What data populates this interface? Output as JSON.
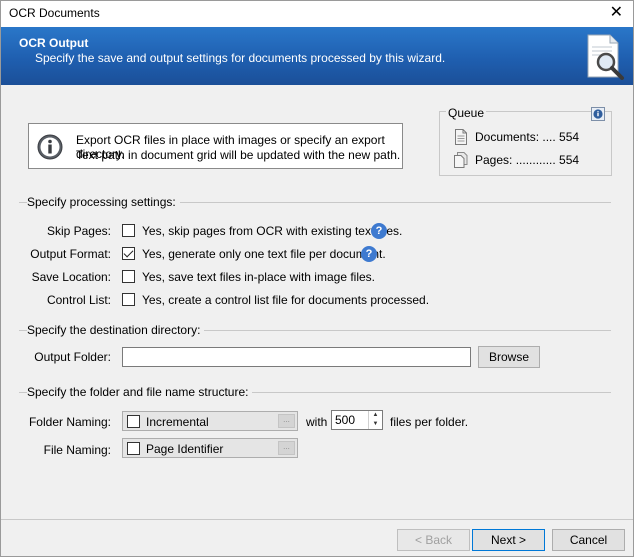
{
  "window": {
    "title": "OCR Documents",
    "close_glyph": "✕"
  },
  "banner": {
    "title": "OCR Output",
    "subtitle": "Specify the save and output settings for documents processed by this wizard.",
    "icon": "document-magnifier-icon"
  },
  "info": {
    "line1": "Export OCR files in place with images or specify an export directory.",
    "line2": "Text path in document grid will be updated with the new path."
  },
  "queue": {
    "title": "Queue",
    "documents_label": "Documents: ....",
    "documents_value": "554",
    "pages_label": "Pages: ............",
    "pages_value": "554"
  },
  "processing": {
    "section_label": "Specify processing settings:",
    "skip_pages": {
      "label": "Skip Pages:",
      "text": "Yes, skip pages from OCR with existing text files.",
      "checked": false
    },
    "output_format": {
      "label": "Output Format:",
      "text": "Yes, generate only one text file per document.",
      "checked": true
    },
    "save_location": {
      "label": "Save Location:",
      "text": "Yes, save text files in-place with image files.",
      "checked": false
    },
    "control_list": {
      "label": "Control List:",
      "text": "Yes, create a control list file for documents processed.",
      "checked": false
    },
    "help_glyph": "?"
  },
  "destination": {
    "section_label": "Specify the destination directory:",
    "output_folder_label": "Output Folder:",
    "output_folder_value": "",
    "browse_label": "Browse"
  },
  "structure": {
    "section_label": "Specify the folder and file name structure:",
    "folder_naming_label": "Folder Naming:",
    "folder_naming_value": "Incremental",
    "with_label": "with",
    "files_per_folder": "500",
    "files_per_folder_label": "files per folder.",
    "file_naming_label": "File Naming:",
    "file_naming_value": "Page Identifier",
    "dots": "..."
  },
  "footer": {
    "back_label": "< Back",
    "next_label": "Next >",
    "cancel_label": "Cancel"
  },
  "colors": {
    "banner_top": "#2a77c9",
    "banner_bottom": "#1b4f98",
    "help_blue": "#3e7ad0",
    "primary_border": "#0078d7"
  }
}
